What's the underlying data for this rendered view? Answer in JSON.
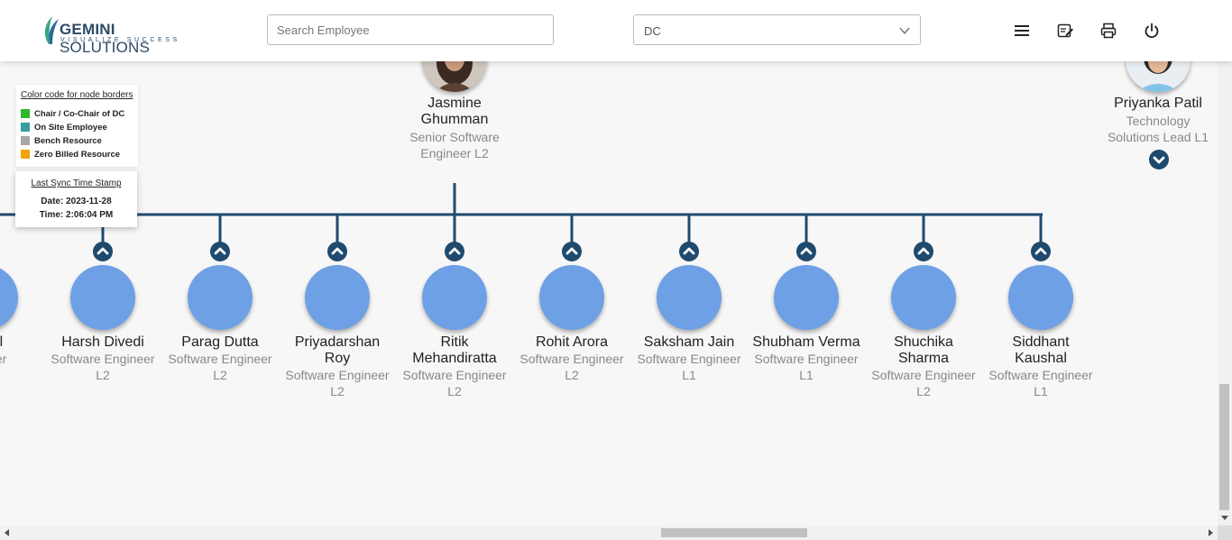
{
  "header": {
    "logo_name_bold": "GEMINI",
    "logo_name_rest": " SOLUTIONS",
    "logo_tagline": "VISUALIZE SUCCESS",
    "search_placeholder": "Search Employee",
    "dc_value": "DC",
    "icons": [
      "menu-icon",
      "edit-note-icon",
      "print-icon",
      "power-icon"
    ]
  },
  "legend": {
    "title": "Color code for node borders",
    "items": [
      {
        "label": "Chair / Co-Chair of DC",
        "color": "#2eb82e"
      },
      {
        "label": "On Site Employee",
        "color": "#3a9e9e"
      },
      {
        "label": "Bench Resource",
        "color": "#a6a6a6"
      },
      {
        "label": "Zero Billed Resource",
        "color": "#f0a30a"
      }
    ]
  },
  "sync": {
    "title": "Last Sync Time Stamp",
    "date": "Date: 2023-11-28",
    "time": "Time: 2:06:04 PM"
  },
  "parent": {
    "name_line1": "Jasmine",
    "name_line2": "Ghumman",
    "title_line1": "Senior Software",
    "title_line2": "Engineer L2"
  },
  "side_node": {
    "name": "Priyanka Patil",
    "title_line1": "Technology",
    "title_line2": "Solutions Lead L1"
  },
  "children": [
    {
      "name_lines": [
        "ansal"
      ],
      "title_lines": [
        "ngineer"
      ]
    },
    {
      "name_lines": [
        "Harsh Divedi"
      ],
      "title_lines": [
        "Software Engineer",
        "L2"
      ]
    },
    {
      "name_lines": [
        "Parag Dutta"
      ],
      "title_lines": [
        "Software Engineer",
        "L2"
      ]
    },
    {
      "name_lines": [
        "Priyadarshan",
        "Roy"
      ],
      "title_lines": [
        "Software Engineer",
        "L2"
      ]
    },
    {
      "name_lines": [
        "Ritik",
        "Mehandiratta"
      ],
      "title_lines": [
        "Software Engineer",
        "L2"
      ]
    },
    {
      "name_lines": [
        "Rohit Arora"
      ],
      "title_lines": [
        "Software Engineer",
        "L2"
      ]
    },
    {
      "name_lines": [
        "Saksham Jain"
      ],
      "title_lines": [
        "Software Engineer",
        "L1"
      ]
    },
    {
      "name_lines": [
        "Shubham Verma"
      ],
      "title_lines": [
        "Software Engineer",
        "L1"
      ]
    },
    {
      "name_lines": [
        "Shuchika",
        "Sharma"
      ],
      "title_lines": [
        "Software Engineer",
        "L2"
      ]
    },
    {
      "name_lines": [
        "Siddhant",
        "Kaushal"
      ],
      "title_lines": [
        "Software Engineer",
        "L1"
      ]
    }
  ],
  "colors": {
    "connector": "#1f4a6e",
    "node_fill": "#6ea0e6",
    "accent": "#2b4a66"
  }
}
